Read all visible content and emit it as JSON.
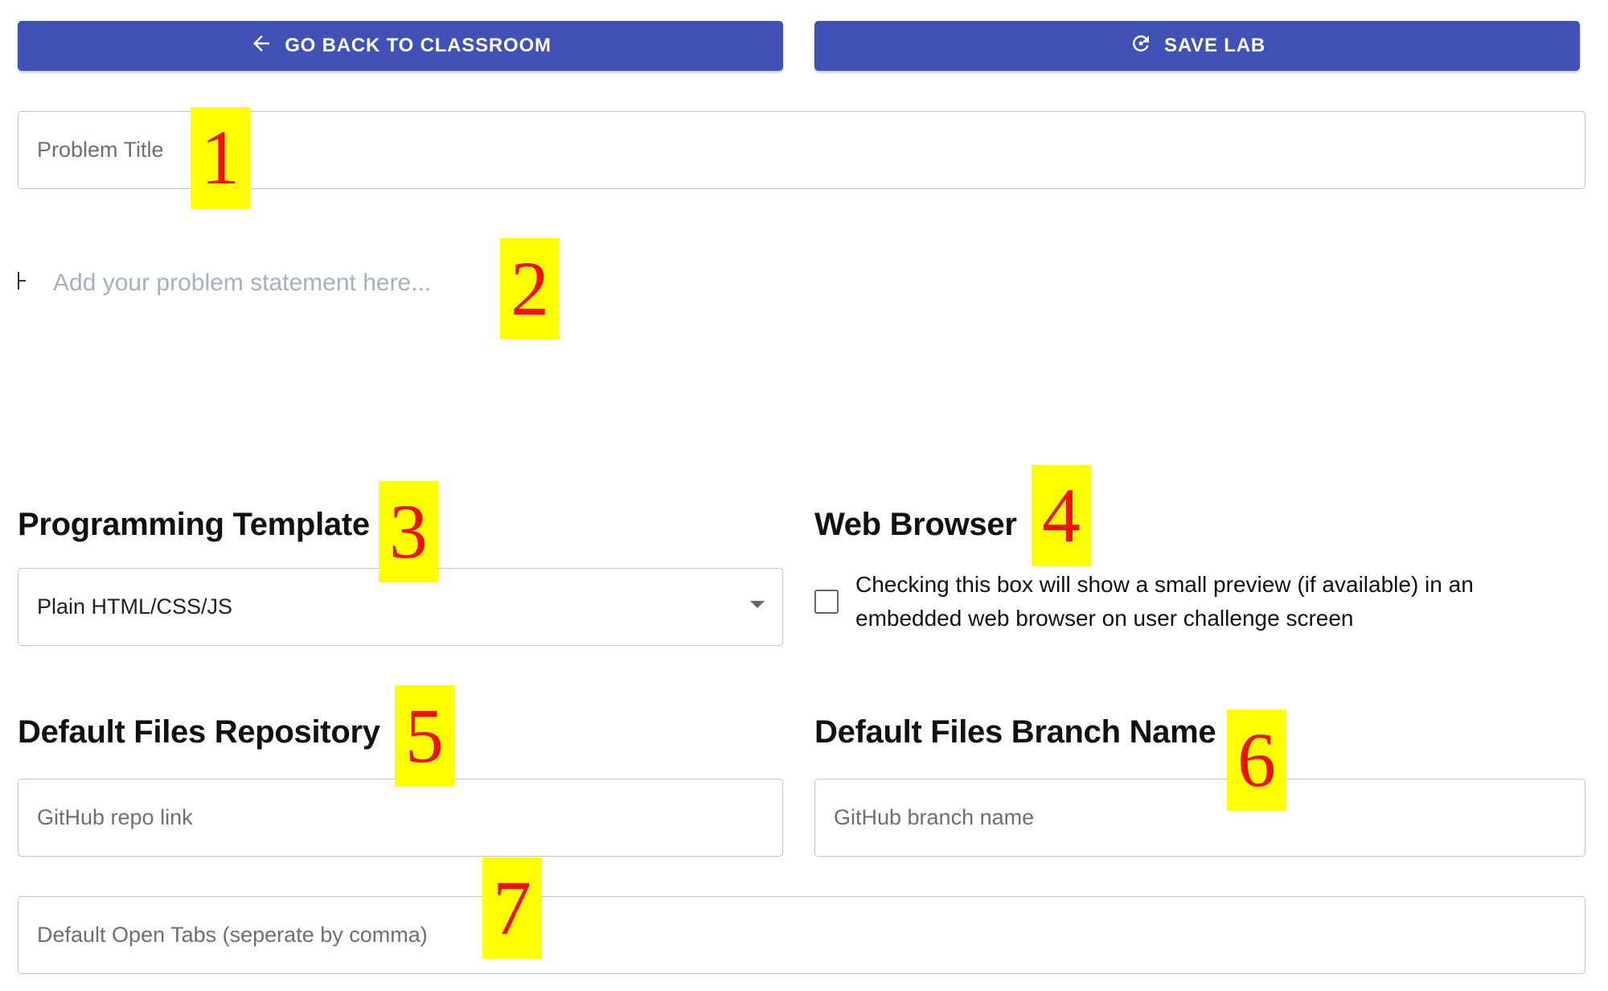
{
  "toolbar": {
    "back_label": "GO BACK TO CLASSROOM",
    "back_icon": "arrow-left-icon",
    "save_label": "SAVE LAB",
    "save_icon": "refresh-save-icon",
    "button_color": "#3f51b5"
  },
  "problem_title": {
    "placeholder": "Problem Title",
    "value": ""
  },
  "problem_statement": {
    "placeholder": "Add your problem statement here..."
  },
  "programming_template": {
    "heading": "Programming Template",
    "selected": "Plain HTML/CSS/JS"
  },
  "web_browser": {
    "heading": "Web Browser",
    "checked": false,
    "checkbox_label": "Checking this box will show a small preview (if available) in an embedded web browser on user challenge screen"
  },
  "default_files_repository": {
    "heading": "Default Files Repository",
    "placeholder": "GitHub repo link"
  },
  "default_files_branch": {
    "heading": "Default Files Branch Name",
    "placeholder": "GitHub branch name"
  },
  "default_open_tabs": {
    "placeholder": "Default Open Tabs (seperate by comma)"
  },
  "markers": [
    "1",
    "2",
    "3",
    "4",
    "5",
    "6",
    "7"
  ],
  "marker_colors": {
    "background": "#ffff00",
    "text": "#ee1111"
  }
}
